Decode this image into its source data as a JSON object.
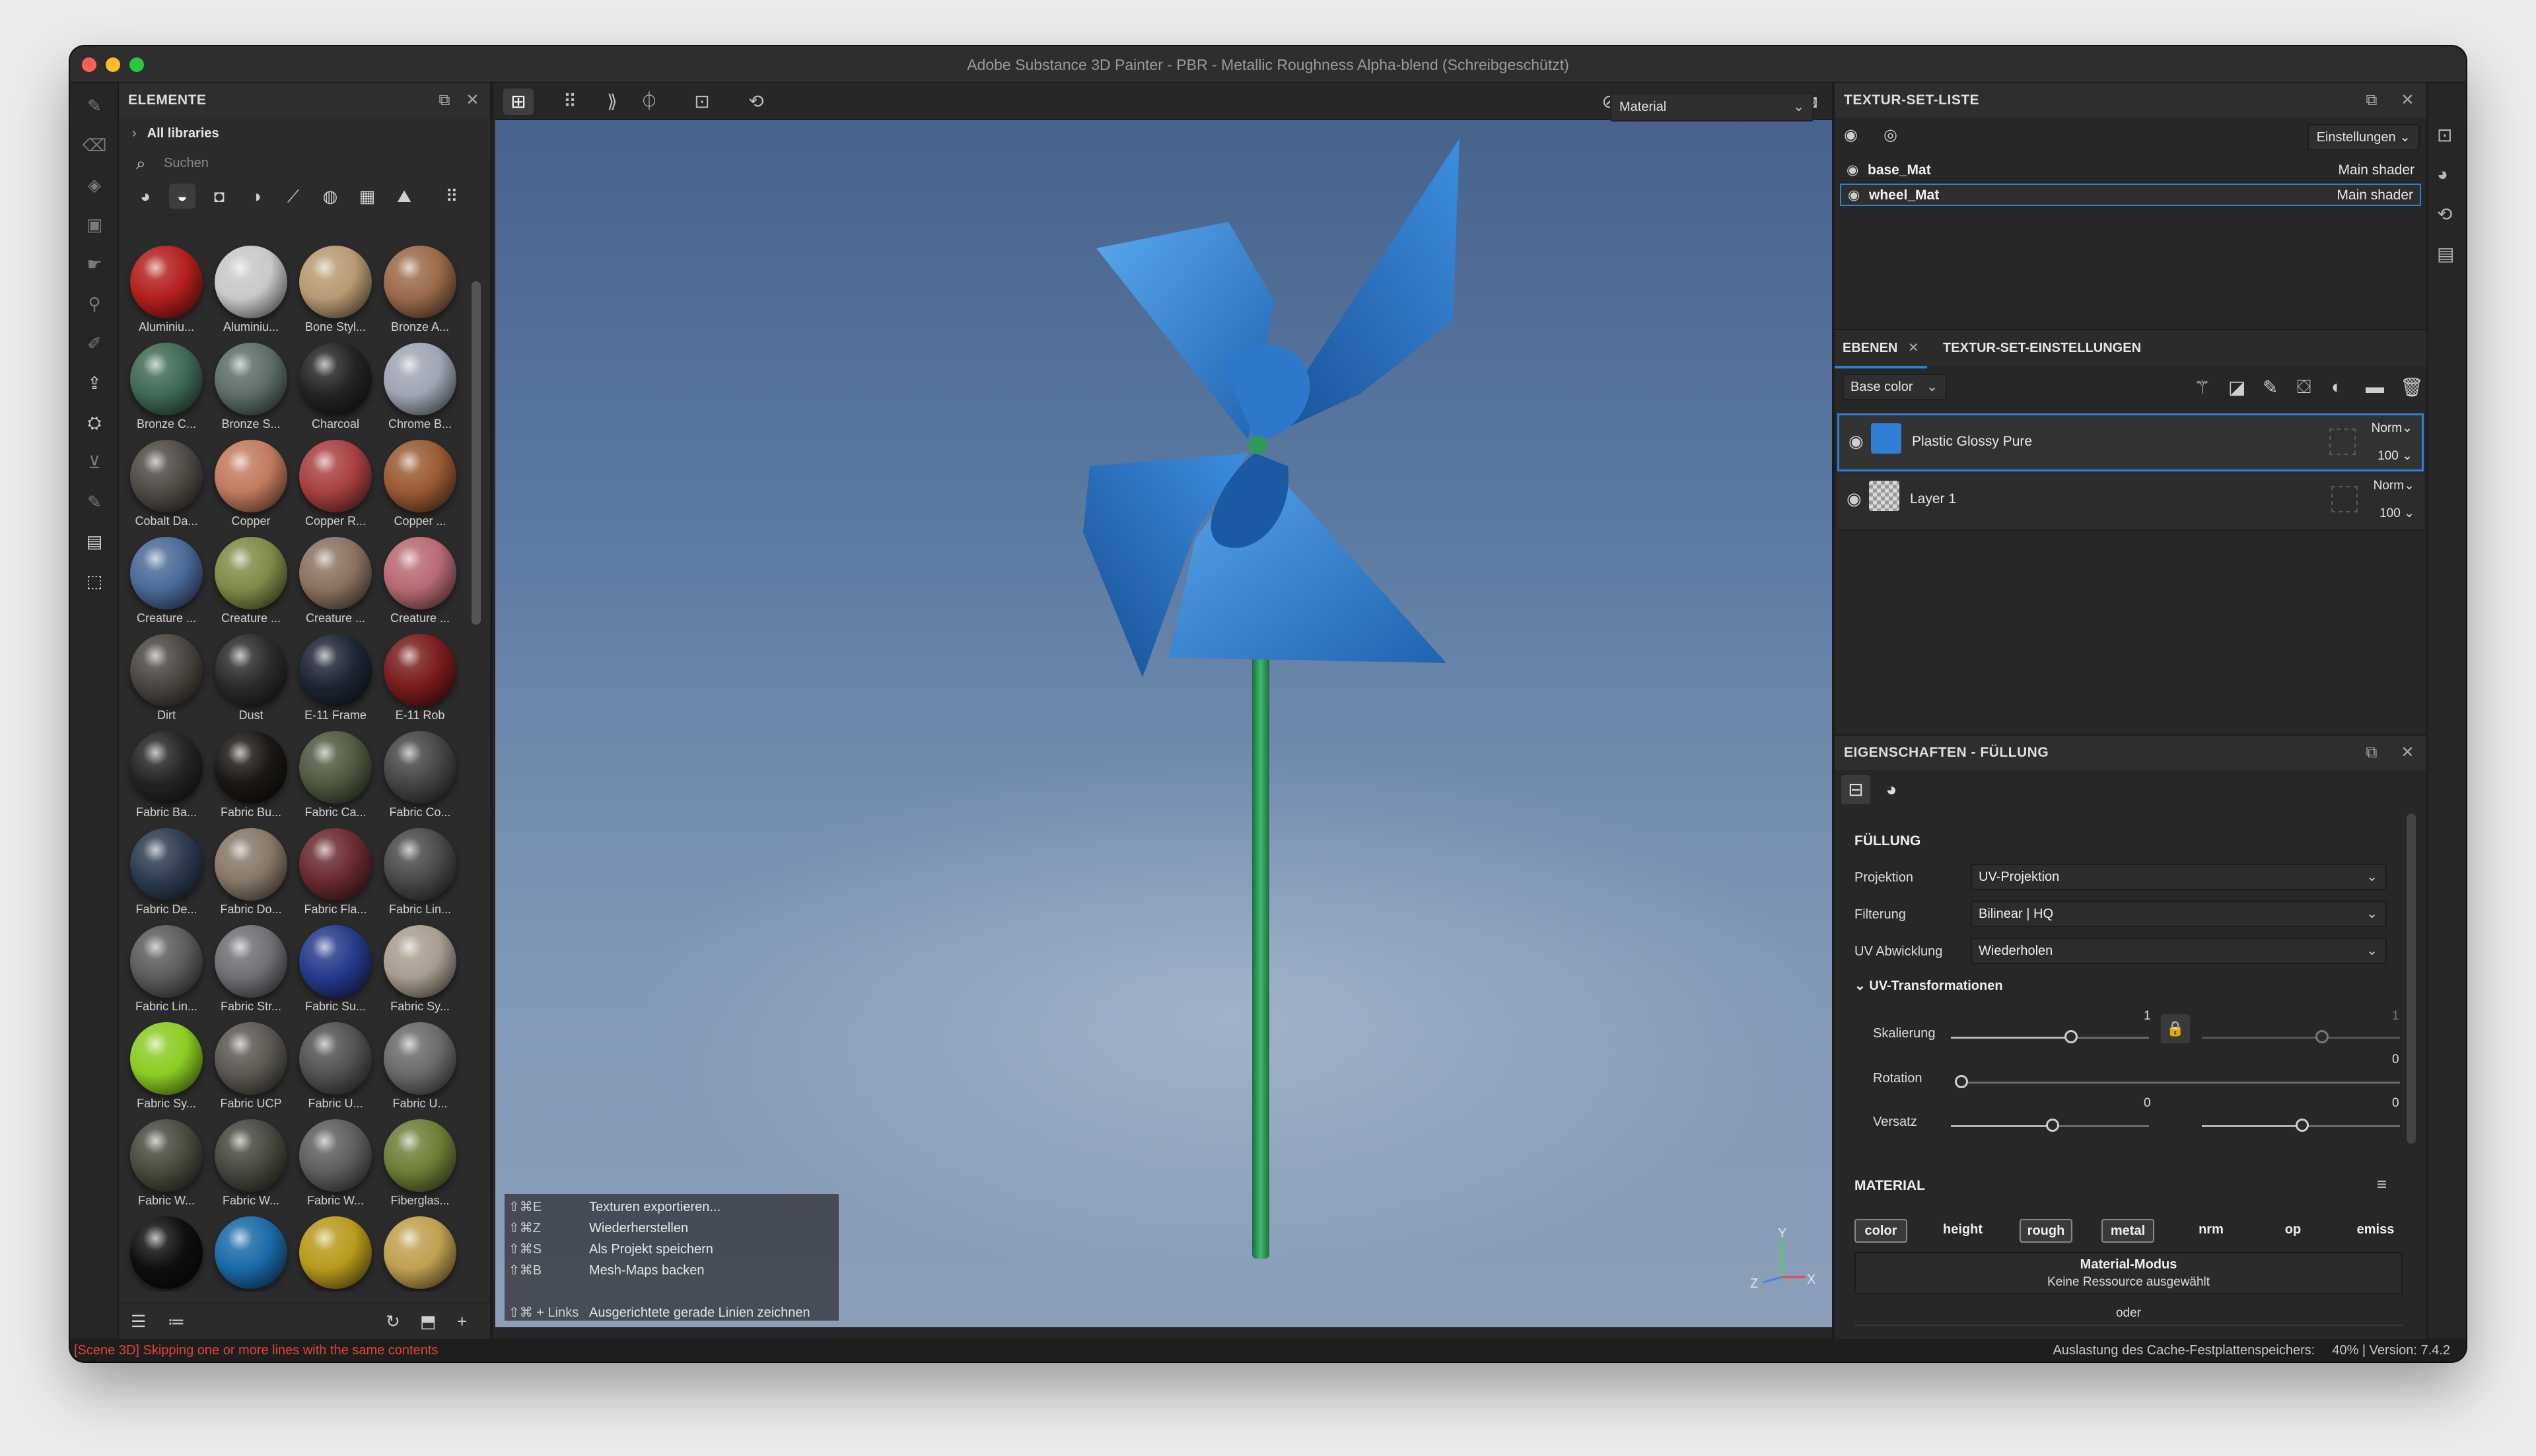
{
  "window": {
    "title": "Adobe Substance 3D Painter - PBR - Metallic Roughness Alpha-blend (Schreibgeschützt)"
  },
  "assets": {
    "title": "ELEMENTE",
    "breadcrumb": "All libraries",
    "search_placeholder": "Suchen",
    "materials": [
      {
        "name": "Aluminiu...",
        "color": "#b3201c"
      },
      {
        "name": "Aluminiu...",
        "color": "#c8c8c8"
      },
      {
        "name": "Bone Styl...",
        "color": "#b89a72"
      },
      {
        "name": "Bronze A...",
        "color": "#9a6a48"
      },
      {
        "name": "Bronze C...",
        "color": "#3f6a55"
      },
      {
        "name": "Bronze S...",
        "color": "#5d6e6a"
      },
      {
        "name": "Charcoal",
        "color": "#232323"
      },
      {
        "name": "Chrome B...",
        "color": "#9ea6b4"
      },
      {
        "name": "Cobalt Da...",
        "color": "#504a44"
      },
      {
        "name": "Copper",
        "color": "#c27a5e"
      },
      {
        "name": "Copper R...",
        "color": "#a84040"
      },
      {
        "name": "Copper ...",
        "color": "#9a5a34"
      },
      {
        "name": "Creature ...",
        "color": "#4a6a98"
      },
      {
        "name": "Creature ...",
        "color": "#7f8c48"
      },
      {
        "name": "Creature ...",
        "color": "#8b7260"
      },
      {
        "name": "Creature ...",
        "color": "#b86a72"
      },
      {
        "name": "Dirt",
        "color": "#4b4640"
      },
      {
        "name": "Dust",
        "color": "#2b2b2b"
      },
      {
        "name": "E-11 Frame",
        "color": "#1e2534"
      },
      {
        "name": "E-11 Rob",
        "color": "#7a1c1c"
      },
      {
        "name": "Fabric Ba...",
        "color": "#242424"
      },
      {
        "name": "Fabric Bu...",
        "color": "#1a1714"
      },
      {
        "name": "Fabric Ca...",
        "color": "#4f5a40"
      },
      {
        "name": "Fabric Co...",
        "color": "#444648"
      },
      {
        "name": "Fabric De...",
        "color": "#2c3c50"
      },
      {
        "name": "Fabric Do...",
        "color": "#877868"
      },
      {
        "name": "Fabric Fla...",
        "color": "#6a2a30"
      },
      {
        "name": "Fabric Lin...",
        "color": "#4a4a4c"
      },
      {
        "name": "Fabric Lin...",
        "color": "#5c5c5c"
      },
      {
        "name": "Fabric Str...",
        "color": "#6e7074"
      },
      {
        "name": "Fabric Su...",
        "color": "#263a8c"
      },
      {
        "name": "Fabric Sy...",
        "color": "#a89e8e"
      },
      {
        "name": "Fabric Sy...",
        "color": "#8ccc22"
      },
      {
        "name": "Fabric UCP",
        "color": "#5a5850"
      },
      {
        "name": "Fabric U...",
        "color": "#545250"
      },
      {
        "name": "Fabric U...",
        "color": "#6a6a68"
      },
      {
        "name": "Fabric W...",
        "color": "#4a4a3e"
      },
      {
        "name": "Fabric W...",
        "color": "#48483e"
      },
      {
        "name": "Fabric W...",
        "color": "#5e5e5c"
      },
      {
        "name": "Fiberglas...",
        "color": "#6e7e36"
      },
      {
        "name": "",
        "color": "#0e0e0e"
      },
      {
        "name": "",
        "color": "#1a6aa8"
      },
      {
        "name": "",
        "color": "#b89a1c"
      },
      {
        "name": "",
        "color": "#c0a050"
      }
    ]
  },
  "viewport": {
    "mode_dropdown": "Material",
    "shortcuts": [
      {
        "keys": "⇧⌘E",
        "label": "Texturen exportieren..."
      },
      {
        "keys": "⇧⌘Z",
        "label": "Wiederherstellen"
      },
      {
        "keys": "⇧⌘S",
        "label": "Als Projekt speichern"
      },
      {
        "keys": "⇧⌘B",
        "label": "Mesh-Maps backen"
      },
      {
        "keys": "⇧⌘ + Links",
        "label": "Ausgerichtete gerade Linien zeichnen"
      }
    ],
    "axis": {
      "x": "X",
      "y": "Y",
      "z": "Z"
    }
  },
  "texture_sets": {
    "title": "TEXTUR-SET-LISTE",
    "settings": "Einstellungen",
    "items": [
      {
        "name": "base_Mat",
        "shader": "Main shader"
      },
      {
        "name": "wheel_Mat",
        "shader": "Main shader"
      }
    ]
  },
  "layers": {
    "tab_layers": "EBENEN",
    "tab_settings": "TEXTUR-SET-EINSTELLUNGEN",
    "channel": "Base color",
    "items": [
      {
        "name": "Plastic Glossy Pure",
        "blend": "Norm",
        "opacity": "100"
      },
      {
        "name": "Layer 1",
        "blend": "Norm",
        "opacity": "100"
      }
    ]
  },
  "properties": {
    "title": "EIGENSCHAFTEN - FÜLLUNG",
    "fill_heading": "FÜLLUNG",
    "projection_label": "Projektion",
    "projection_value": "UV-Projektion",
    "filter_label": "Filterung",
    "filter_value": "Bilinear | HQ",
    "wrap_label": "UV Abwicklung",
    "wrap_value": "Wiederholen",
    "uv_heading": "UV-Transformationen",
    "scale_label": "Skalierung",
    "scale_value": "1",
    "scale_value2": "1",
    "rotation_label": "Rotation",
    "rotation_value": "0",
    "offset_label": "Versatz",
    "offset_value1": "0",
    "offset_value2": "0",
    "material_heading": "MATERIAL",
    "channels": [
      "color",
      "height",
      "rough",
      "metal",
      "nrm",
      "op",
      "emiss"
    ],
    "mode_title": "Material-Modus",
    "mode_sub": "Keine Ressource ausgewählt",
    "or": "oder"
  },
  "status": {
    "left": "[Scene 3D] Skipping one or more lines with the same contents",
    "cache": "Auslastung des Cache-Festplattenspeichers:",
    "usage": "40% | Version: 7.4.2"
  }
}
